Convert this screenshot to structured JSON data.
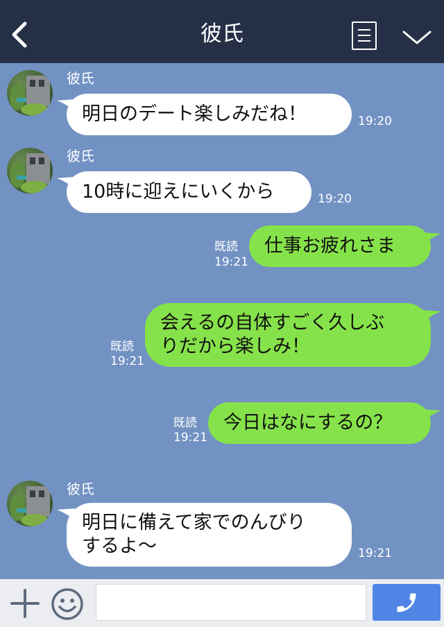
{
  "header": {
    "title": "彼氏"
  },
  "messages": [
    {
      "direction": "in",
      "sender": "彼氏",
      "lines": [
        "明日のデート楽しみだね！"
      ],
      "time": "19:20"
    },
    {
      "direction": "in",
      "sender": "彼氏",
      "lines": [
        "10時に迎えにいくから"
      ],
      "time": "19:20"
    },
    {
      "direction": "out",
      "lines": [
        "仕事お疲れさま"
      ],
      "status": "既読",
      "time": "19:21"
    },
    {
      "direction": "out",
      "lines": [
        "会えるの自体すごく久しぶ",
        "りだから楽しみ！"
      ],
      "status": "既読",
      "time": "19:21"
    },
    {
      "direction": "out",
      "lines": [
        "今日はなにするの？"
      ],
      "status": "既読",
      "time": "19:21"
    },
    {
      "direction": "in",
      "sender": "彼氏",
      "lines": [
        "明日に備えて家でのんびり",
        "するよ〜"
      ],
      "time": "19:21"
    }
  ],
  "composer": {
    "placeholder": ""
  },
  "colors": {
    "header_bg": "#253047",
    "chat_bg": "#7292c3",
    "incoming": "#ffffff",
    "outgoing": "#86e24a",
    "call_button": "#4f86e6"
  },
  "icons": [
    "back-icon",
    "menu-icon",
    "chevron-down-icon",
    "plus-icon",
    "emoji-icon",
    "phone-icon"
  ]
}
